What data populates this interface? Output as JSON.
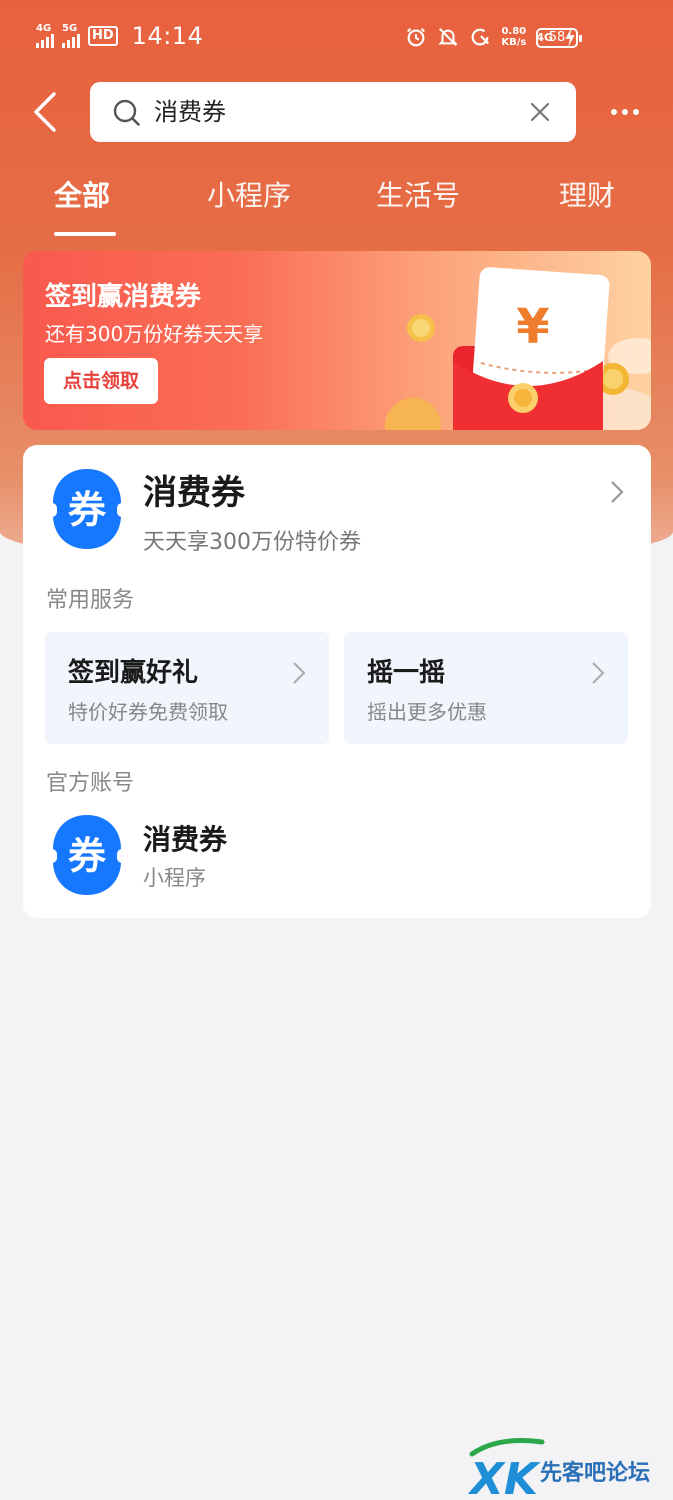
{
  "status_bar": {
    "net1": "4G",
    "net2": "5G",
    "hd_label": "HD",
    "time": "14:14",
    "speed_value": "0.80",
    "speed_unit": "KB/s",
    "net_right": "4G",
    "battery": "58"
  },
  "search": {
    "query": "消费券"
  },
  "tabs": [
    {
      "label": "全部",
      "active": true
    },
    {
      "label": "小程序",
      "active": false
    },
    {
      "label": "生活号",
      "active": false
    },
    {
      "label": "理财",
      "active": false
    }
  ],
  "banner": {
    "title": "签到赢消费券",
    "subtitle": "还有300万份好券天天享",
    "button_label": "点击领取",
    "icon": "red-envelope-yuan-icon"
  },
  "result": {
    "logo_char": "券",
    "title": "消费券",
    "subtitle": "天天享300万份特价券"
  },
  "services": {
    "section_label": "常用服务",
    "items": [
      {
        "title": "签到赢好礼",
        "subtitle": "特价好券免费领取"
      },
      {
        "title": "摇一摇",
        "subtitle": "摇出更多优惠"
      }
    ]
  },
  "official": {
    "section_label": "官方账号",
    "logo_char": "券",
    "title": "消费券",
    "subtitle": "小程序"
  },
  "watermark": {
    "logo": "XK",
    "text": "先客吧论坛"
  },
  "colors": {
    "brand_orange": "#e8613f",
    "logo_blue": "#1677ff",
    "banner_button_text": "#e8403a"
  }
}
